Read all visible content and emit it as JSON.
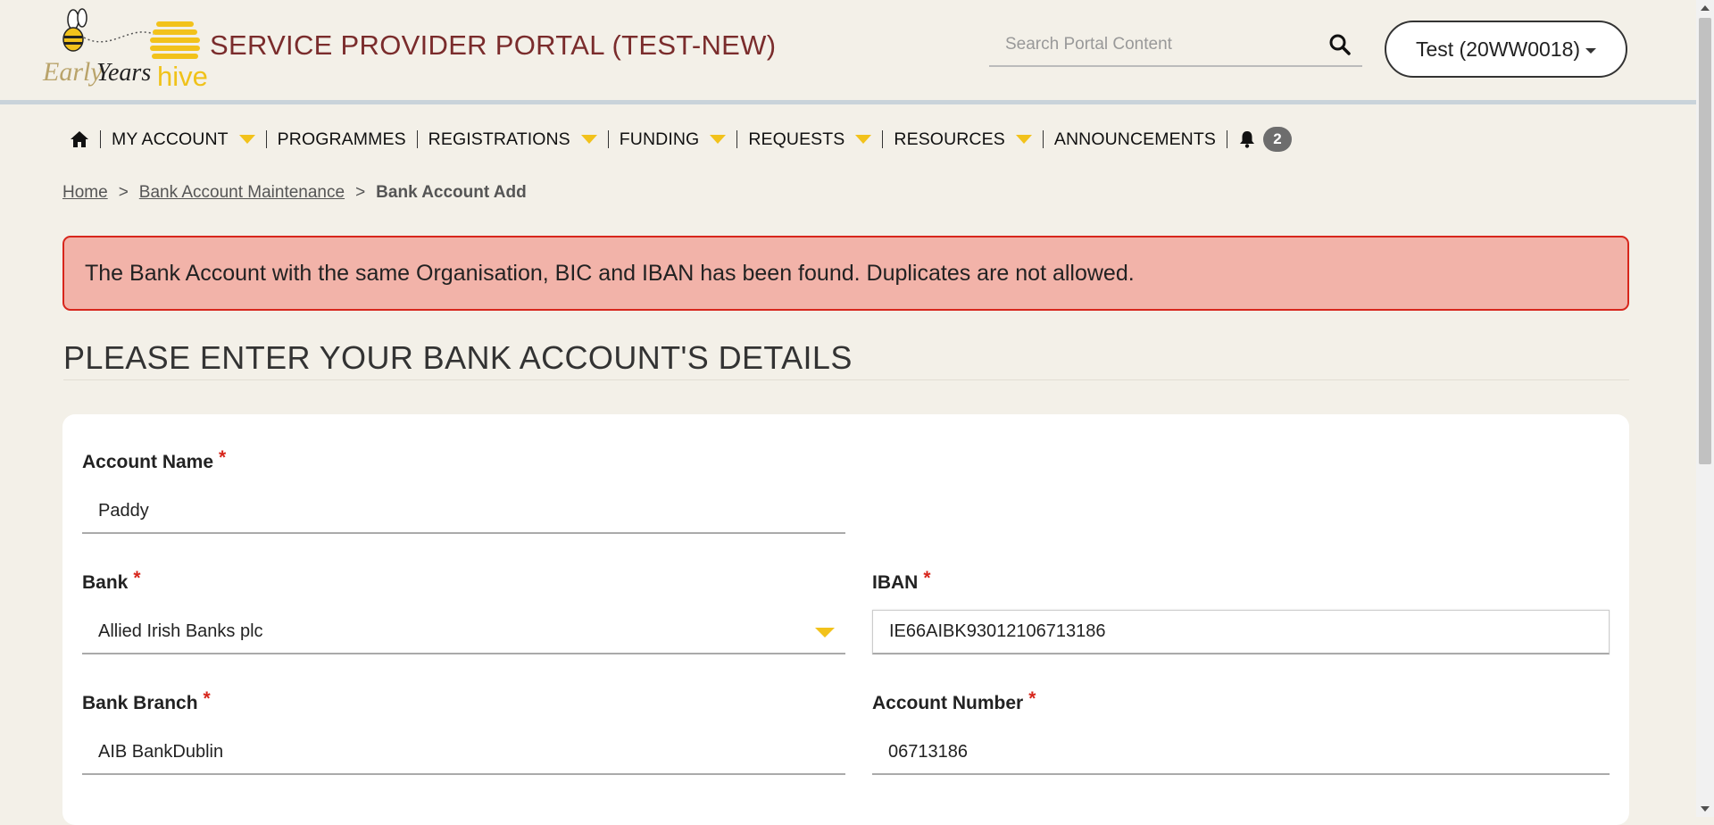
{
  "header": {
    "logo": {
      "early": "Early",
      "years": "Years",
      "hive": "hive"
    },
    "portal_title": "SERVICE PROVIDER PORTAL (TEST-NEW)",
    "search_placeholder": "Search Portal Content",
    "account_label": "Test (20WW0018)"
  },
  "nav": {
    "items": [
      {
        "label": "MY ACCOUNT",
        "has_dropdown": true
      },
      {
        "label": "PROGRAMMES",
        "has_dropdown": false
      },
      {
        "label": "REGISTRATIONS",
        "has_dropdown": true
      },
      {
        "label": "FUNDING",
        "has_dropdown": true
      },
      {
        "label": "REQUESTS",
        "has_dropdown": true
      },
      {
        "label": "RESOURCES",
        "has_dropdown": true
      },
      {
        "label": "ANNOUNCEMENTS",
        "has_dropdown": false
      }
    ],
    "notification_count": "2"
  },
  "breadcrumb": {
    "home": "Home",
    "maintenance": "Bank Account Maintenance",
    "current": "Bank Account Add",
    "separator": ">"
  },
  "alert": {
    "message": "The Bank Account with the same Organisation, BIC and IBAN has been found. Duplicates are not allowed."
  },
  "section": {
    "heading": "PLEASE ENTER YOUR BANK ACCOUNT'S DETAILS"
  },
  "form": {
    "required_marker": "*",
    "account_name": {
      "label": "Account Name",
      "value": "Paddy"
    },
    "bank": {
      "label": "Bank",
      "value": "Allied Irish Banks plc"
    },
    "iban": {
      "label": "IBAN",
      "value": "IE66AIBK93012106713186"
    },
    "bank_branch": {
      "label": "Bank Branch",
      "value": "AIB BankDublin"
    },
    "account_number": {
      "label": "Account Number",
      "value": "06713186"
    }
  },
  "colors": {
    "accent_yellow": "#f2c21b",
    "title_maroon": "#7a2c2c",
    "alert_bg": "#f2b3a9",
    "alert_border": "#d7261c",
    "page_bg": "#f3f0e8"
  }
}
